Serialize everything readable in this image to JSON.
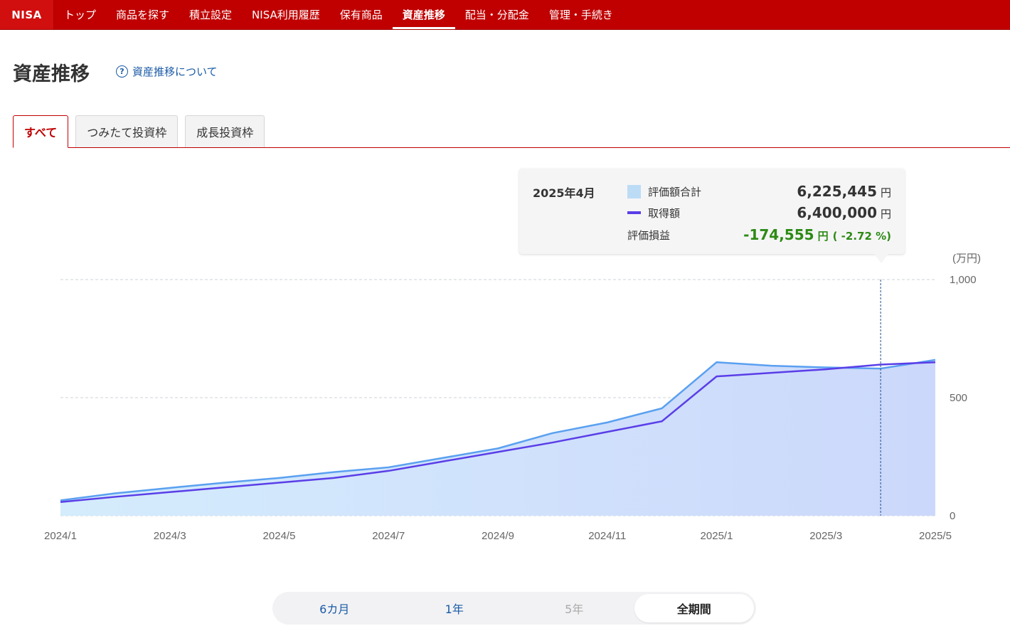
{
  "nav": {
    "logo": "NISA",
    "items": [
      {
        "label": "トップ",
        "active": false
      },
      {
        "label": "商品を探す",
        "active": false
      },
      {
        "label": "積立設定",
        "active": false
      },
      {
        "label": "NISA利用履歴",
        "active": false
      },
      {
        "label": "保有商品",
        "active": false
      },
      {
        "label": "資産推移",
        "active": true
      },
      {
        "label": "配当・分配金",
        "active": false
      },
      {
        "label": "管理・手続き",
        "active": false
      }
    ]
  },
  "page": {
    "title": "資産推移",
    "help_label": "資産推移について",
    "help_icon": "question-circle-icon"
  },
  "tabs": [
    {
      "label": "すべて",
      "active": true
    },
    {
      "label": "つみたて投資枠",
      "active": false
    },
    {
      "label": "成長投資枠",
      "active": false
    }
  ],
  "tooltip": {
    "month": "2025年4月",
    "valuation_label": "評価額合計",
    "valuation_value": "6,225,445",
    "cost_label": "取得額",
    "cost_value": "6,400,000",
    "gain_label": "評価損益",
    "gain_value": "-174,555",
    "gain_pct": "( -2.72 %)",
    "unit": "円"
  },
  "chart_data": {
    "type": "area",
    "unit_label": "(万円)",
    "ylim": [
      0,
      1000
    ],
    "y_ticks": [
      {
        "value": 0,
        "label": "0"
      },
      {
        "value": 500,
        "label": "500"
      },
      {
        "value": 1000,
        "label": "1,000"
      }
    ],
    "x_tick_labels": [
      "2024/1",
      "2024/3",
      "2024/5",
      "2024/7",
      "2024/9",
      "2024/11",
      "2025/1",
      "2025/3",
      "2025/5"
    ],
    "x_months": [
      "2024/1",
      "2024/2",
      "2024/3",
      "2024/4",
      "2024/5",
      "2024/6",
      "2024/7",
      "2024/8",
      "2024/9",
      "2024/10",
      "2024/11",
      "2024/12",
      "2025/1",
      "2025/2",
      "2025/3",
      "2025/4",
      "2025/5"
    ],
    "series": [
      {
        "name": "評価額合計",
        "kind": "area",
        "color": "#5aa0f0",
        "values": [
          65,
          95,
          118,
          140,
          160,
          185,
          205,
          245,
          285,
          350,
          395,
          455,
          650,
          635,
          628,
          623,
          660
        ]
      },
      {
        "name": "取得額",
        "kind": "line",
        "color": "#5a3ee8",
        "values": [
          58,
          80,
          100,
          120,
          140,
          160,
          190,
          230,
          270,
          310,
          355,
          400,
          590,
          605,
          620,
          640,
          650
        ]
      }
    ],
    "highlight_month": "2025/4",
    "grid": true
  },
  "period": [
    {
      "label": "6カ月",
      "state": "enabled"
    },
    {
      "label": "1年",
      "state": "enabled"
    },
    {
      "label": "5年",
      "state": "disabled"
    },
    {
      "label": "全期間",
      "state": "active"
    }
  ]
}
